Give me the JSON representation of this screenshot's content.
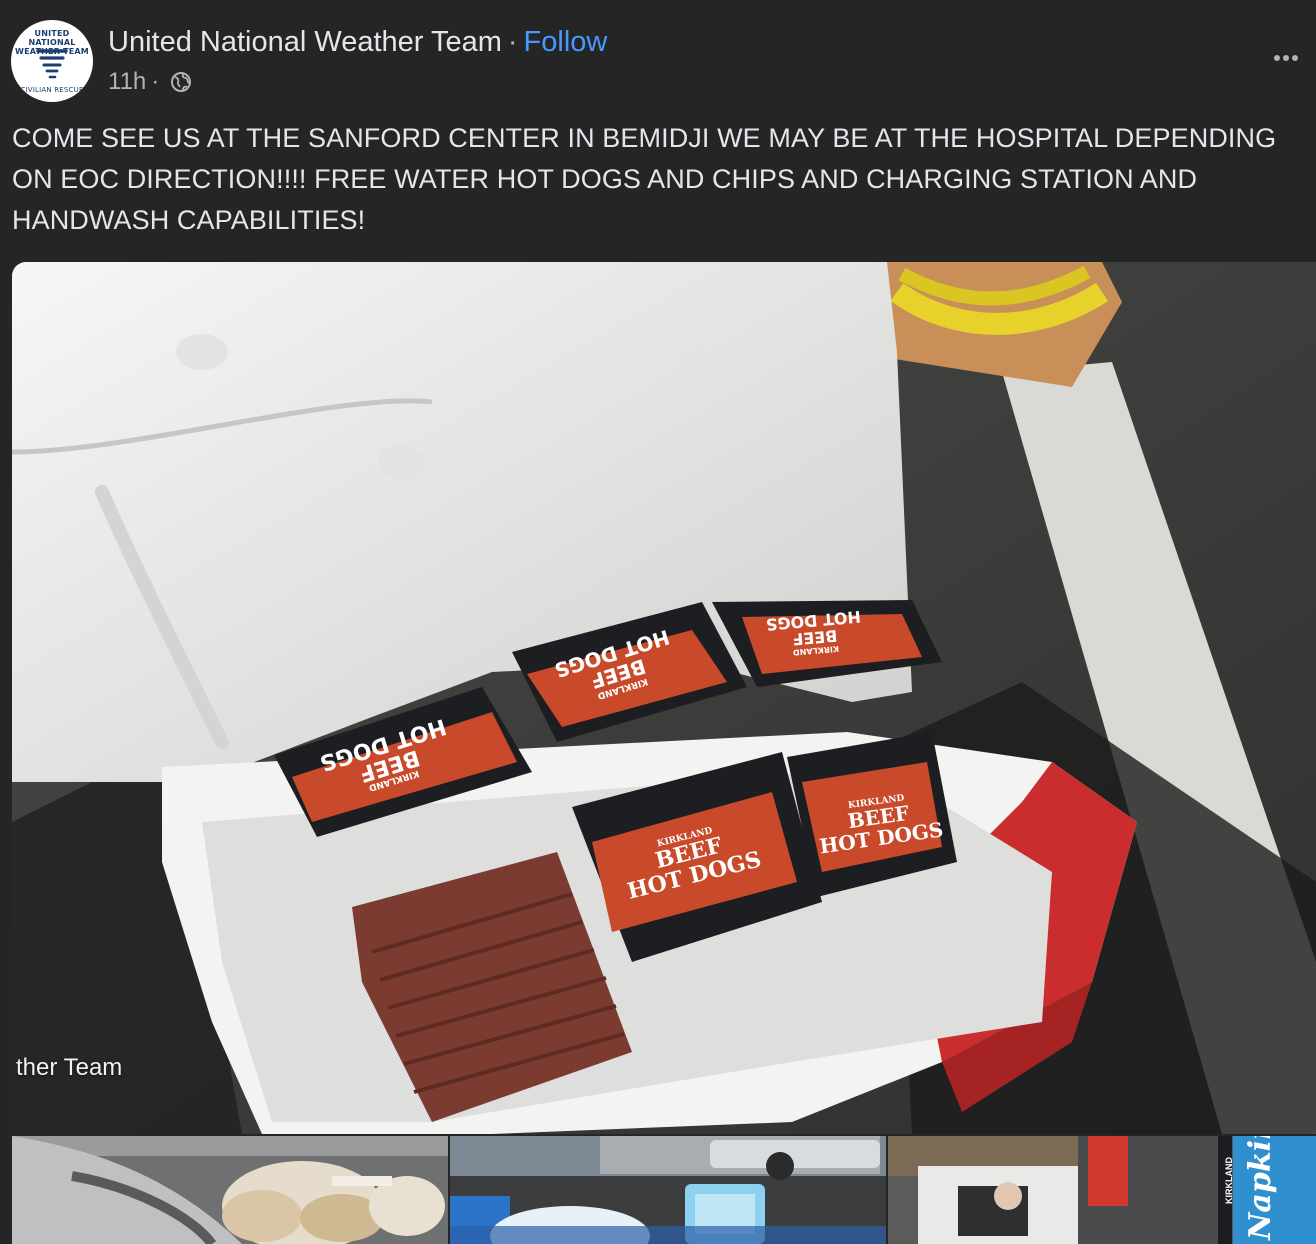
{
  "post": {
    "page_name": "United National Weather Team",
    "separator": "·",
    "follow_label": "Follow",
    "timestamp": "11h",
    "meta_separator": "·",
    "audience_icon": "globe-icon",
    "more_icon": "more-options-icon",
    "avatar": {
      "ring_top": "UNITED NATIONAL WEATHER TEAM",
      "ring_bottom": "CIVILIAN RESCUE"
    },
    "body": "COME SEE US AT THE SANFORD CENTER IN BEMIDJI WE MAY BE AT THE HOSPITAL DEPENDING ON EOC DIRECTION!!!! FREE WATER HOT DOGS AND CHIPS AND CHARGING STATION AND HANDWASH CAPABILITIES!"
  },
  "photo": {
    "watermark": "ther Team",
    "packages": [
      {
        "brand": "KIRKLAND",
        "line1": "BEEF",
        "line2": "HOT DOGS"
      },
      {
        "brand": "KIRKLAND",
        "line1": "BEEF",
        "line2": "HOT DOGS"
      },
      {
        "brand": "KIRKLAND",
        "line1": "BEEF",
        "line2": "HOT DOGS"
      },
      {
        "brand": "KIRKLAND",
        "line1": "BEEF",
        "line2": "HOT DOGS"
      },
      {
        "brand": "KIRKLAND",
        "line1": "BEEF",
        "line2": "HOT DOGS"
      }
    ]
  },
  "thumbnails": {
    "thumb3_brand": "KIRKLAND",
    "thumb3_product": "Napkin"
  },
  "colors": {
    "background": "#252526",
    "link": "#4599ff",
    "text": "#e4e6eb",
    "secondary_text": "#b0b3b8"
  }
}
